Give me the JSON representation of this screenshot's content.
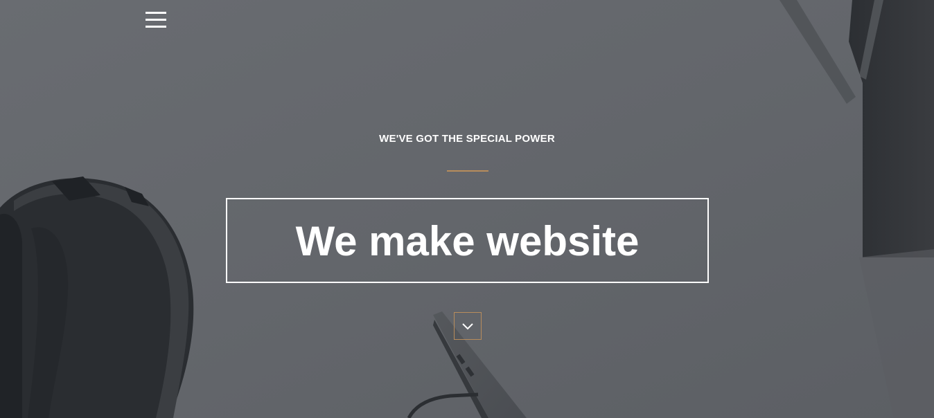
{
  "nav": {
    "menu_icon": "hamburger-menu-icon"
  },
  "hero": {
    "tagline": "WE'VE GOT THE SPECIAL POWER",
    "headline": "We make website",
    "scroll_icon": "chevron-down-icon"
  },
  "colors": {
    "accent": "#b88d5c",
    "overlay": "#62656a",
    "text": "#ffffff"
  }
}
